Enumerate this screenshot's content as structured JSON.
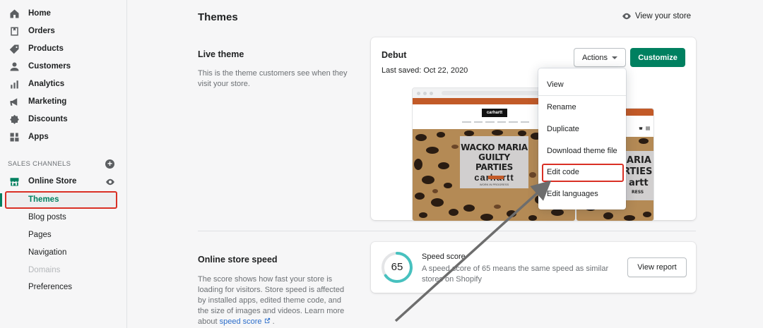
{
  "sidebar": {
    "items": [
      {
        "label": "Home",
        "icon": "home-icon"
      },
      {
        "label": "Orders",
        "icon": "orders-icon"
      },
      {
        "label": "Products",
        "icon": "tag-icon"
      },
      {
        "label": "Customers",
        "icon": "person-icon"
      },
      {
        "label": "Analytics",
        "icon": "bar-chart-icon"
      },
      {
        "label": "Marketing",
        "icon": "megaphone-icon"
      },
      {
        "label": "Discounts",
        "icon": "discount-icon"
      },
      {
        "label": "Apps",
        "icon": "apps-icon"
      }
    ],
    "sales_channels_label": "SALES CHANNELS",
    "online_store": "Online Store",
    "sub_items": [
      "Themes",
      "Blog posts",
      "Pages",
      "Navigation",
      "Domains",
      "Preferences"
    ]
  },
  "main": {
    "title": "Themes",
    "view_store": "View your store",
    "live_theme": {
      "title": "Live theme",
      "description": "This is the theme customers see when they visit your store.",
      "theme_name": "Debut",
      "last_saved": "Last saved: Oct 22, 2020",
      "actions_label": "Actions",
      "customize_label": "Customize"
    },
    "actions_menu": [
      "View",
      "Rename",
      "Duplicate",
      "Download theme file",
      "Edit code",
      "Edit languages"
    ],
    "preview": {
      "logo": "carhartt",
      "promo_line1": "WACKO MARIA",
      "promo_line2": "GUILTY PARTIES",
      "promo_line3": "carhartt",
      "promo_line4": "WORK IN PROGRESS",
      "mobile_line1": "MARIA",
      "mobile_line2": "RTIES",
      "mobile_line3": "artt",
      "mobile_line4": "RESS"
    },
    "speed": {
      "title": "Online store speed",
      "description": "The score shows how fast your store is loading for visitors. Store speed is affected by installed apps, edited theme code, and the size of images and videos. Learn more about",
      "link": "speed score",
      "link_suffix": ".",
      "score": "65",
      "score_value": 65,
      "score_title": "Speed score",
      "score_desc": "A speed score of 65 means the same speed as similar stores on Shopify",
      "report_label": "View report"
    }
  },
  "colors": {
    "accent": "#008060",
    "highlight": "#d93025",
    "link": "#2c6ecb"
  }
}
